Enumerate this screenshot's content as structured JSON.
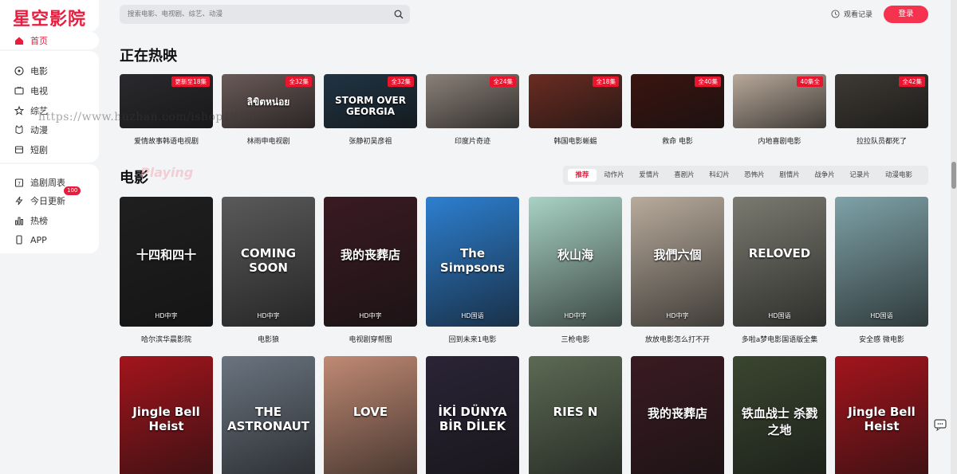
{
  "app": {
    "logo": "星空影院"
  },
  "sidebar": {
    "home": "首页",
    "group1": [
      {
        "label": "电影",
        "icon": "film-icon"
      },
      {
        "label": "电视",
        "icon": "tv-icon"
      },
      {
        "label": "综艺",
        "icon": "star-icon"
      },
      {
        "label": "动漫",
        "icon": "anime-icon"
      },
      {
        "label": "短剧",
        "icon": "short-icon"
      }
    ],
    "group2": [
      {
        "label": "追剧周表",
        "icon": "calendar-icon"
      },
      {
        "label": "今日更新",
        "icon": "update-icon",
        "badge": "100"
      },
      {
        "label": "热榜",
        "icon": "chart-icon"
      },
      {
        "label": "APP",
        "icon": "phone-icon"
      }
    ]
  },
  "header": {
    "search_placeholder": "搜索电影、电视剧、综艺、动漫",
    "history": "观看记录",
    "login": "登录"
  },
  "hot": {
    "title": "正在热映",
    "items": [
      {
        "caption": "爱情故事韩语电视剧",
        "tag": "更新至18集",
        "color": "#2a2a2e"
      },
      {
        "caption": "林雨申电视剧",
        "tag": "全32集",
        "color": "#6a5a58",
        "text": "ลิขิตหน่อย"
      },
      {
        "caption": "张静初吴彦祖",
        "tag": "全32集",
        "color": "#203444",
        "text": "STORM OVER GEORGIA"
      },
      {
        "caption": "印度片奇迹",
        "tag": "全24集",
        "color": "#8a8078"
      },
      {
        "caption": "韩国电影蜥蜴",
        "tag": "全18集",
        "color": "#6a2c22"
      },
      {
        "caption": "救命 电影",
        "tag": "全40集",
        "color": "#3b1410"
      },
      {
        "caption": "内地喜剧电影",
        "tag": "40集全",
        "color": "#b8a89a"
      },
      {
        "caption": "拉拉队员都死了",
        "tag": "全42集",
        "color": "#3e3a34"
      }
    ]
  },
  "movies": {
    "title": "电影",
    "ghost": "Playing",
    "tabs": [
      "推荐",
      "动作片",
      "爱情片",
      "喜剧片",
      "科幻片",
      "恐怖片",
      "剧情片",
      "战争片",
      "记录片",
      "动漫电影"
    ],
    "row1": [
      {
        "caption": "哈尔滨华晨影院",
        "quality": "HD中字",
        "color": "#1f1f1f",
        "text": "十四和四十"
      },
      {
        "caption": "电影狼",
        "quality": "HD中字",
        "color": "#5a5a5a",
        "text": "COMING SOON"
      },
      {
        "caption": "电视剧穿帮图",
        "quality": "HD中字",
        "color": "#3a1a22",
        "text": "我的丧葬店"
      },
      {
        "caption": "回到未来1电影",
        "quality": "HD国语",
        "color": "#2d7fd0",
        "text": "The Simpsons"
      },
      {
        "caption": "三枪电影",
        "quality": "HD中字",
        "color": "#a8d2c4",
        "text": "秋山海"
      },
      {
        "caption": "放放电影怎么打不开",
        "quality": "HD中字",
        "color": "#b8ab9c",
        "text": "我們六個"
      },
      {
        "caption": "多啦a梦电影国语版全集",
        "quality": "HD国语",
        "color": "#7a7a70",
        "text": "RELOVED"
      },
      {
        "caption": "安全感 微电影",
        "quality": "HD国语",
        "color": "#7ea2a8"
      }
    ],
    "row2": [
      {
        "color": "#a3141c",
        "text": "Jingle Bell Heist"
      },
      {
        "color": "#6a7480",
        "text": "THE ASTRONAUT"
      },
      {
        "color": "#c08a74",
        "text": "LOVE"
      },
      {
        "color": "#2a2436",
        "text": "İKİ DÜNYA BİR DİLEK"
      },
      {
        "color": "#5c6a54",
        "text": "RIES N"
      },
      {
        "color": "#3a1a22",
        "text": "我的丧葬店"
      },
      {
        "color": "#3a4630",
        "text": "铁血战士 杀戮之地"
      },
      {
        "color": "#a3141c",
        "text": "Jingle Bell Heist"
      }
    ]
  },
  "watermark": "https://www.huzhan.com/ishop19189",
  "colors": {
    "accent": "#ea1c3d",
    "login": "#f5334f",
    "tag": "#e8152e"
  }
}
